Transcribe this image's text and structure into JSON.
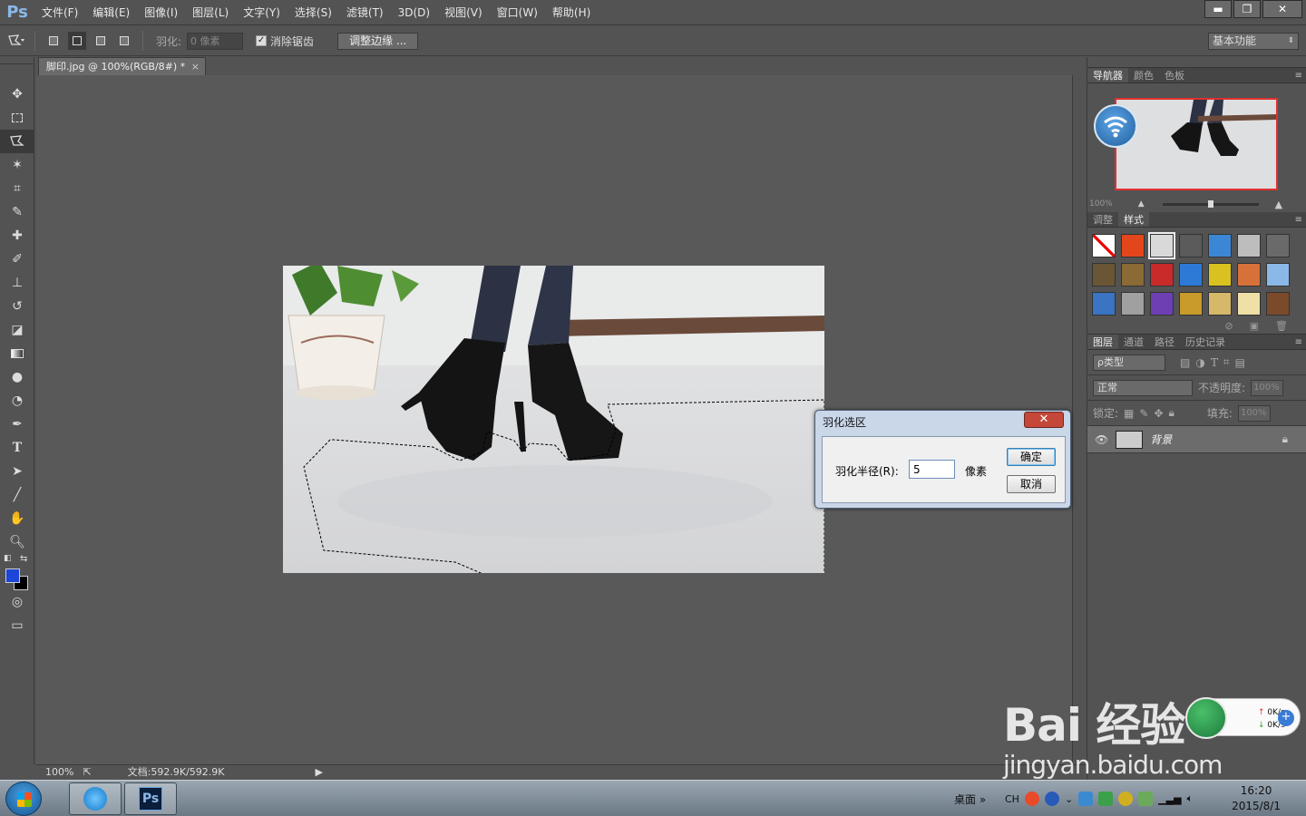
{
  "app": {
    "logo": "Ps"
  },
  "menu": [
    "文件(F)",
    "编辑(E)",
    "图像(I)",
    "图层(L)",
    "文字(Y)",
    "选择(S)",
    "滤镜(T)",
    "3D(D)",
    "视图(V)",
    "窗口(W)",
    "帮助(H)"
  ],
  "window_controls": {
    "minimize": "▬",
    "restore": "❐",
    "close": "✕"
  },
  "options": {
    "feather_label": "羽化:",
    "feather_value": "0 像素",
    "antialias_label": "消除锯齿",
    "antialias_checked": "✓",
    "refine_edge": "调整边缘 ...",
    "workspace": "基本功能"
  },
  "document": {
    "tab_title": "脚印.jpg @ 100%(RGB/8#) *",
    "tab_close": "×",
    "zoom": "100%",
    "doc_size": "文档:592.9K/592.9K"
  },
  "colors": {
    "foreground": "#1c46d8",
    "background": "#000000",
    "canvas_bg": "#595959",
    "panel_bg": "#535353"
  },
  "tools": [
    "move-icon",
    "marquee-icon",
    "polygonal-lasso-icon",
    "magic-wand-icon",
    "crop-icon",
    "eyedropper-icon",
    "healing-brush-icon",
    "brush-icon",
    "stamp-icon",
    "history-brush-icon",
    "eraser-icon",
    "gradient-icon",
    "blur-icon",
    "dodge-icon",
    "pen-icon",
    "type-icon",
    "path-select-icon",
    "line-icon",
    "hand-icon",
    "zoom-icon"
  ],
  "navigator_panel": {
    "tabs": [
      "导航器",
      "颜色",
      "色板"
    ],
    "zoom": "100%"
  },
  "styles_panel": {
    "tabs": [
      "调整",
      "样式"
    ],
    "swatches": [
      "#ffffff",
      "#e4461b",
      "#d9d9d9",
      "#5b5b5b",
      "#3b87d6",
      "#bdbdbd",
      "#6a6a6a",
      "#6a5534",
      "#8a6a35",
      "#c92a2a",
      "#2c7ad6",
      "#d9c21f",
      "#d6713a",
      "#8ab8e8",
      "#3a74c2",
      "#a0a0a0",
      "#6c3fb2",
      "#c89b2a",
      "#d6b86a",
      "#efe0a8",
      "#7a4a2a"
    ]
  },
  "layers_panel": {
    "tabs": [
      "图层",
      "通道",
      "路径",
      "历史记录"
    ],
    "filter_type": "ρ类型",
    "blend_mode": "正常",
    "opacity_label": "不透明度:",
    "opacity_value": "100%",
    "lock_label": "锁定:",
    "fill_label": "填充:",
    "fill_value": "100%",
    "layer_name": "背景"
  },
  "dialog": {
    "title": "羽化选区",
    "close": "✕",
    "radius_label": "羽化半径(R):",
    "radius_value": "5",
    "unit": "像素",
    "ok": "确定",
    "cancel": "取消"
  },
  "taskbar": {
    "desktop": "桌面",
    "desktop_arrow": "»",
    "ime": "CH",
    "time": "16:20",
    "date": "2015/8/1",
    "ps_label": "Ps"
  },
  "net_widget": {
    "up": "0K/s",
    "down": "0K/s",
    "plus": "+"
  },
  "watermark": {
    "logo": "Bai 经验",
    "url": "jingyan.baidu.com"
  }
}
